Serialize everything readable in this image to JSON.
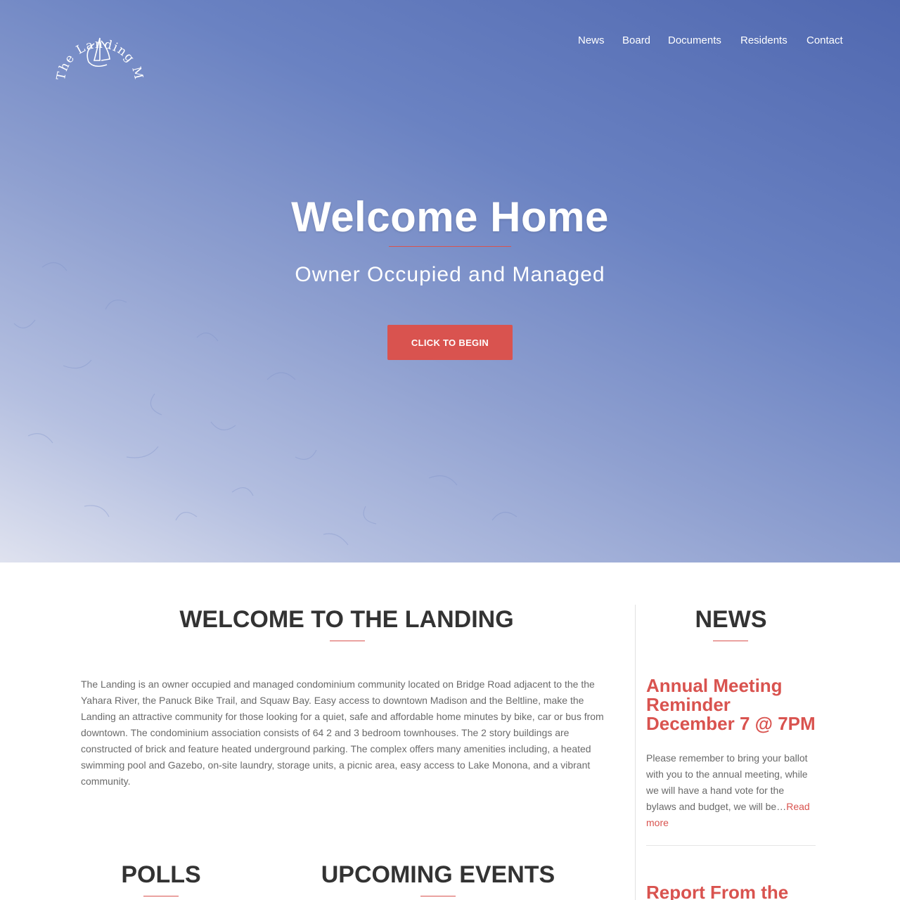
{
  "brand": {
    "logo_text": "The Landing Madison"
  },
  "nav": {
    "items": [
      "News",
      "Board",
      "Documents",
      "Residents",
      "Contact"
    ]
  },
  "hero": {
    "title": "Welcome Home",
    "subtitle": "Owner Occupied and Managed",
    "cta_label": "CLICK TO BEGIN"
  },
  "welcome": {
    "title": "WELCOME TO THE LANDING",
    "body": "The Landing is an owner occupied and managed condominium community located on Bridge Road adjacent to the the Yahara River, the Panuck Bike Trail, and Squaw Bay. Easy access to downtown Madison and the Beltline, make the Landing an attractive community for those looking for a quiet, safe and affordable home minutes by bike, car or bus from downtown. The condominium association consists of 64 2 and 3 bedroom townhouses. The 2 story buildings are constructed of brick and feature heated underground parking. The complex offers many amenities including, a heated swimming pool and Gazebo, on-site laundry, storage units, a picnic area, easy access to Lake Monona, and a vibrant community."
  },
  "polls": {
    "title": "POLLS"
  },
  "events": {
    "title": "UPCOMING EVENTS"
  },
  "news": {
    "title": "NEWS",
    "items": [
      {
        "headline": "Annual Meeting Reminder December 7 @ 7PM",
        "excerpt": "Please remember to bring your ballot with you to the annual meeting, while we will have a hand vote for the bylaws and budget, we will be…",
        "read_more": "Read more"
      },
      {
        "headline": "Report From the"
      }
    ]
  },
  "colors": {
    "accent": "#d9534f",
    "hero_top": "#5068b0",
    "hero_bottom": "#dfe2ef",
    "heading": "#333333",
    "body_text": "#6a6a6a"
  }
}
